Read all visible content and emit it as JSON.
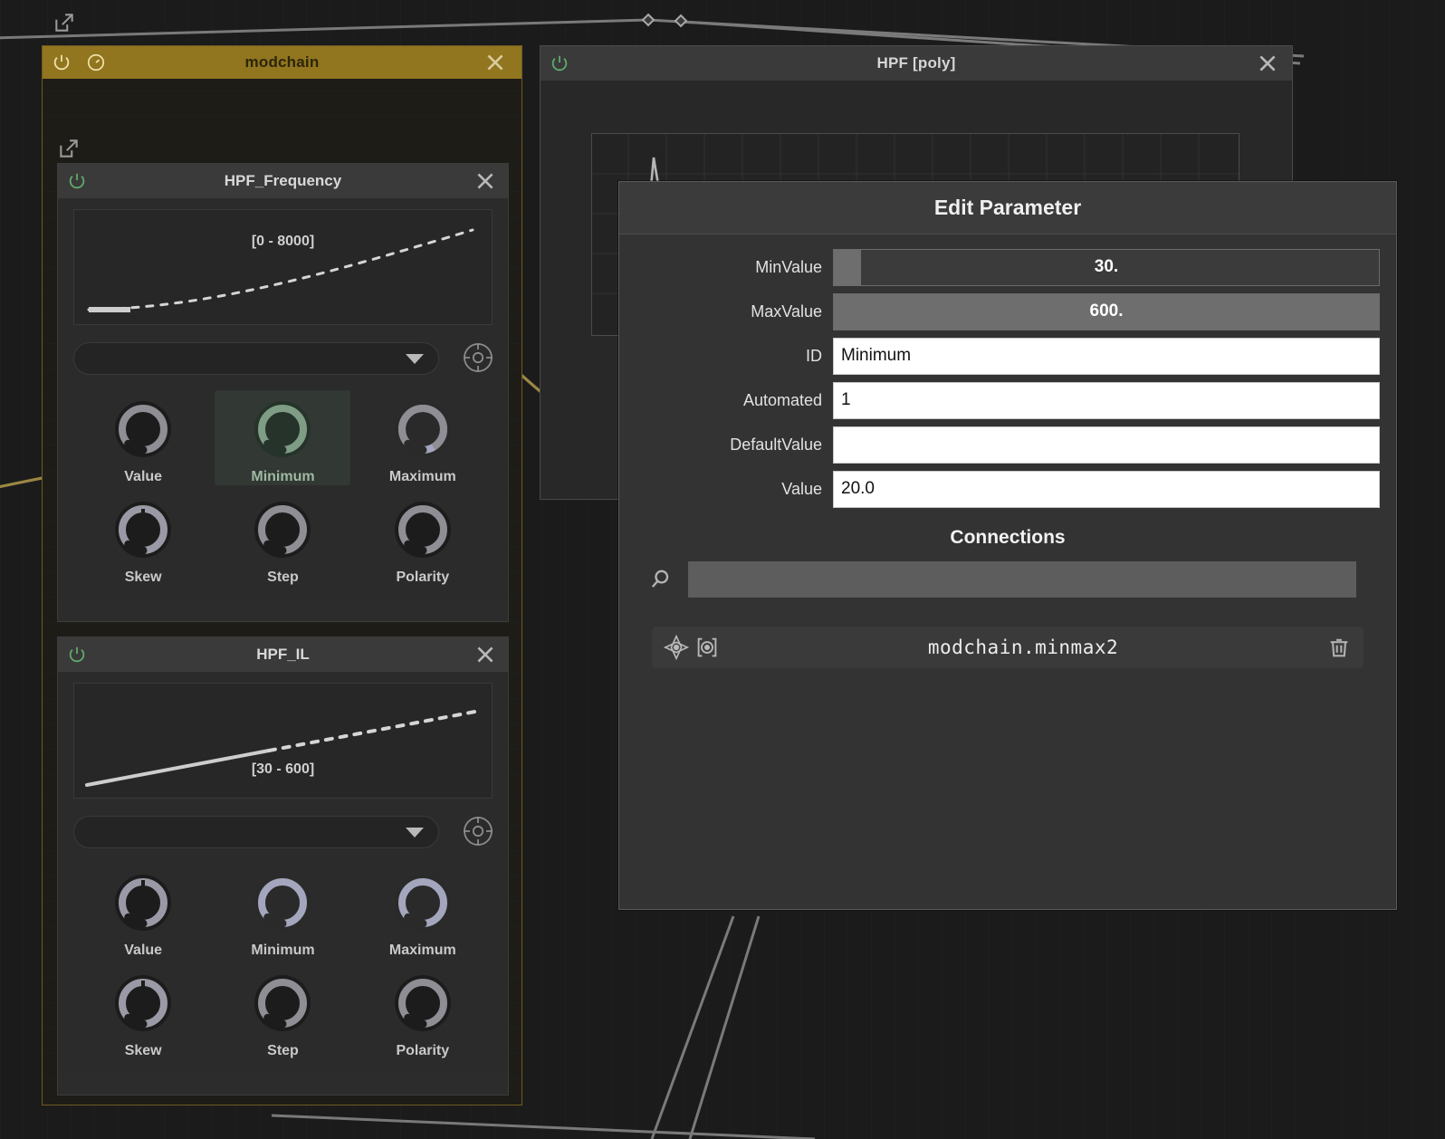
{
  "canvas": {
    "background_color": "#1b1b1b"
  },
  "modchain_panel": {
    "title": "modchain",
    "header_color": "#91751f",
    "power_icon": "power-icon",
    "clock_icon": "clock-icon",
    "close_icon": "close-icon",
    "expand_icon": "external-link-icon",
    "modules": [
      {
        "title": "HPF_Frequency",
        "range_label": "[0 - 8000]",
        "curve_type": "exponential",
        "dropdown_value": "",
        "dropdown_icon": "chevron-down-icon",
        "target_icon": "crosshair-icon",
        "knobs_row1": [
          {
            "label": "Value",
            "selected": false,
            "value_pct": 0
          },
          {
            "label": "Minimum",
            "selected": true,
            "value_pct": 0
          },
          {
            "label": "Maximum",
            "selected": false,
            "value_pct": 88
          }
        ],
        "knobs_row2": [
          {
            "label": "Skew",
            "selected": false,
            "value_pct": 55
          },
          {
            "label": "Step",
            "selected": false,
            "value_pct": 0
          },
          {
            "label": "Polarity",
            "selected": false,
            "value_pct": 0
          }
        ]
      },
      {
        "title": "HPF_IL",
        "range_label": "[30 - 600]",
        "curve_type": "linear",
        "dropdown_value": "",
        "dropdown_icon": "chevron-down-icon",
        "target_icon": "crosshair-icon",
        "knobs_row1": [
          {
            "label": "Value",
            "selected": false,
            "value_pct": 50
          },
          {
            "label": "Minimum",
            "selected": false,
            "value_pct": 80
          },
          {
            "label": "Maximum",
            "selected": false,
            "value_pct": 92
          }
        ],
        "knobs_row2": [
          {
            "label": "Skew",
            "selected": false,
            "value_pct": 50
          },
          {
            "label": "Step",
            "selected": false,
            "value_pct": 0
          },
          {
            "label": "Polarity",
            "selected": false,
            "value_pct": 0
          }
        ]
      }
    ]
  },
  "hpf_panel": {
    "title": "HPF [poly]",
    "power_icon": "power-icon",
    "close_icon": "close-icon"
  },
  "dialog": {
    "title": "Edit Parameter",
    "fields": [
      {
        "label": "MinValue",
        "type": "slider",
        "value": "30.",
        "fill_pct": 5
      },
      {
        "label": "MaxValue",
        "type": "slider",
        "value": "600.",
        "fill_pct": 100
      },
      {
        "label": "ID",
        "type": "text",
        "value": "Minimum"
      },
      {
        "label": "Automated",
        "type": "text",
        "value": "1"
      },
      {
        "label": "DefaultValue",
        "type": "text",
        "value": ""
      },
      {
        "label": "Value",
        "type": "text",
        "value": "20.0"
      }
    ],
    "connections": {
      "heading": "Connections",
      "search_icon": "search-icon",
      "search_placeholder": "",
      "search_value": "",
      "items": [
        {
          "name": "modchain.minmax2",
          "target_icon": "crosshair-icon",
          "camera_icon": "snapshot-icon",
          "delete_icon": "trash-icon"
        }
      ]
    }
  }
}
